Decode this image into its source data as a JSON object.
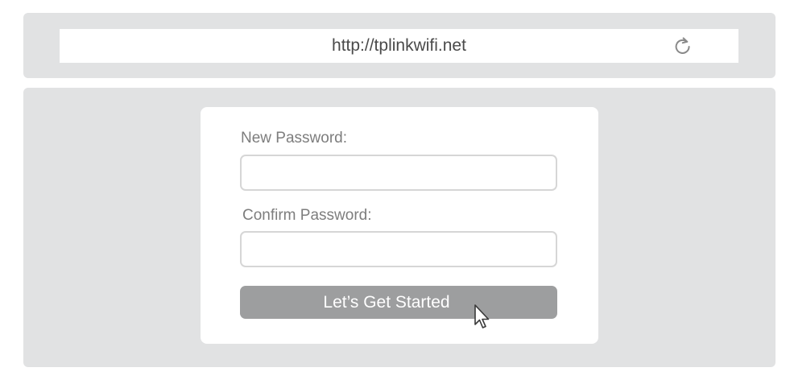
{
  "browser": {
    "url": "http://tplinkwifi.net",
    "refresh_icon": "refresh-icon"
  },
  "form": {
    "new_password_label": "New Password:",
    "new_password_value": "",
    "confirm_password_label": "Confirm Password:",
    "confirm_password_value": "",
    "submit_label": "Let’s Get Started"
  },
  "cursor_icon": "mouse-pointer-icon",
  "colors": {
    "frame": "#e1e2e3",
    "button": "#9d9e9f",
    "label_text": "#7d7d7d",
    "input_border": "#d6d6d6"
  }
}
